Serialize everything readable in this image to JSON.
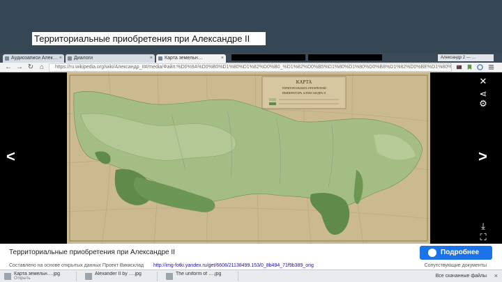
{
  "slide": {
    "title": "Территориальные приобретения при Александре II"
  },
  "browser": {
    "tabs": [
      {
        "label": "Аудиозаписи Алек…",
        "close": "×"
      },
      {
        "label": "Диалоги",
        "close": "×"
      },
      {
        "label": "Карта земельн…",
        "close": "×",
        "active": true
      }
    ],
    "tabbar_right": "Александр 2 — …",
    "url": "https://ru.wikipedia.org/wiki/Александр_II#/media/Файл:%D0%9A%D0%B0%D1%80%D1%82%D0%B0_%D1%82%D0%B5%D1%80%D1%80%D0%B8%D1%82%D0%BE%D1%80%D0%B8%D0%B0%D0%BB%D1%8C%D0%BD%D1%8B%D1%85.jpg"
  },
  "lightbox": {
    "prev_icon": "chevron-left-icon",
    "next_icon": "chevron-right-icon",
    "map_title": "КАРТА",
    "map_subtitle_1": "ТЕРРИТОРІАЛЬНЫХЪ ПРІОБРѢТЕНІЙ",
    "map_subtitle_2": "ИМПЕРАТОРА АЛЕКСАНДРА II"
  },
  "caption": {
    "text": "Территориальные приобретения при Александре II",
    "more_label": "Подробнее"
  },
  "source": {
    "left": "Составлено на основе открытых данных Проект Викисклад",
    "link": "http://img-fotki.yandex.ru/get/6608/21138499.153/0_8b494_71f9b389_orig",
    "right": "Сопутствующие документы"
  },
  "downloads": {
    "items": [
      {
        "name": "Карта земельн….jpg",
        "sub": "Открыть"
      },
      {
        "name": "Alexander II by ….jpg",
        "sub": ""
      },
      {
        "name": "The uniform of ….jpg",
        "sub": ""
      }
    ],
    "show_all": "Все скачанные файлы",
    "close": "×"
  },
  "colors": {
    "header": "#354654",
    "accent": "#1a73e8",
    "map_paper": "#c9b78d",
    "map_green": "#9ab57a",
    "map_dark_green": "#5f8a4a"
  }
}
